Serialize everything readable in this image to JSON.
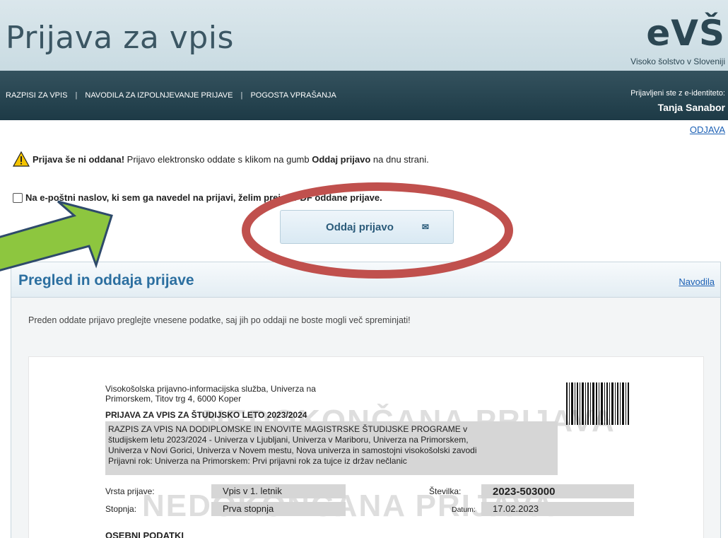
{
  "header": {
    "title": "Prijava za vpis",
    "logo": "eVŠ",
    "logo_subtitle": "Visoko šolstvo v Sloveniji"
  },
  "nav": {
    "items": [
      "RAZPISI ZA VPIS",
      "NAVODILA ZA IZPOLNJEVANJE PRIJAVE",
      "POGOSTA VPRAŠANJA"
    ],
    "separator": "|",
    "login_label": "Prijavljeni ste z e-identiteto:",
    "user_name": "Tanja Sanabor",
    "logout": "ODJAVA"
  },
  "warning": {
    "bold_start": "Prijava še ni oddana!",
    "text_mid": " Prijavo elektronsko oddate s klikom na gumb ",
    "bold_button": "Oddaj prijavo",
    "text_end": " na dnu strani."
  },
  "pdf_option": {
    "label": "Na e-poštni naslov, ki sem ga navedel na prijavi, želim prejeti PDF oddane prijave.",
    "checked": false
  },
  "submit_button": {
    "label": "Oddaj prijavo",
    "icon": "envelope-icon"
  },
  "section": {
    "title": "Pregled in oddaja prijave",
    "help_link": "Navodila",
    "intro": "Preden oddate prijavo preglejte vnesene podatke, saj jih po oddaji ne boste mogli več spreminjati!"
  },
  "document": {
    "org": "Visokošolska prijavno-informacijska služba, Univerza na Primorskem, Titov trg 4, 6000 Koper",
    "title": "PRIJAVA ZA VPIS ZA ŠTUDIJSKO LETO 2023/2024",
    "call_lines": [
      "RAZPIS ZA VPIS NA DODIPLOMSKE IN ENOVITE MAGISTRSKE ŠTUDIJSKE PROGRAME v",
      "študijskem letu 2023/2024 - Univerza v Ljubljani, Univerza v Mariboru, Univerza na Primorskem,",
      "Univerza v Novi Gorici, Univerza v Novem mestu, Nova univerza in samostojni visokošolski zavodi",
      "Prijavni rok: Univerza na Primorskem: Prvi prijavni rok za tujce iz držav nečlanic"
    ],
    "watermark": "NEDOKONČANA PRIJAVA",
    "fields": {
      "type_label": "Vrsta prijave:",
      "type_value": "Vpis v 1. letnik",
      "level_label": "Stopnja:",
      "level_value": "Prva stopnja",
      "number_label": "Številka:",
      "number_value": "2023-503000",
      "date_label": "Datum:",
      "date_value": "17.02.2023"
    },
    "personal_heading": "OSEBNI PODATKI"
  },
  "annotations": {
    "arrow_color": "#8dc63f",
    "arrow_outline": "#2e4a6b",
    "circle_color": "#c0504d"
  }
}
